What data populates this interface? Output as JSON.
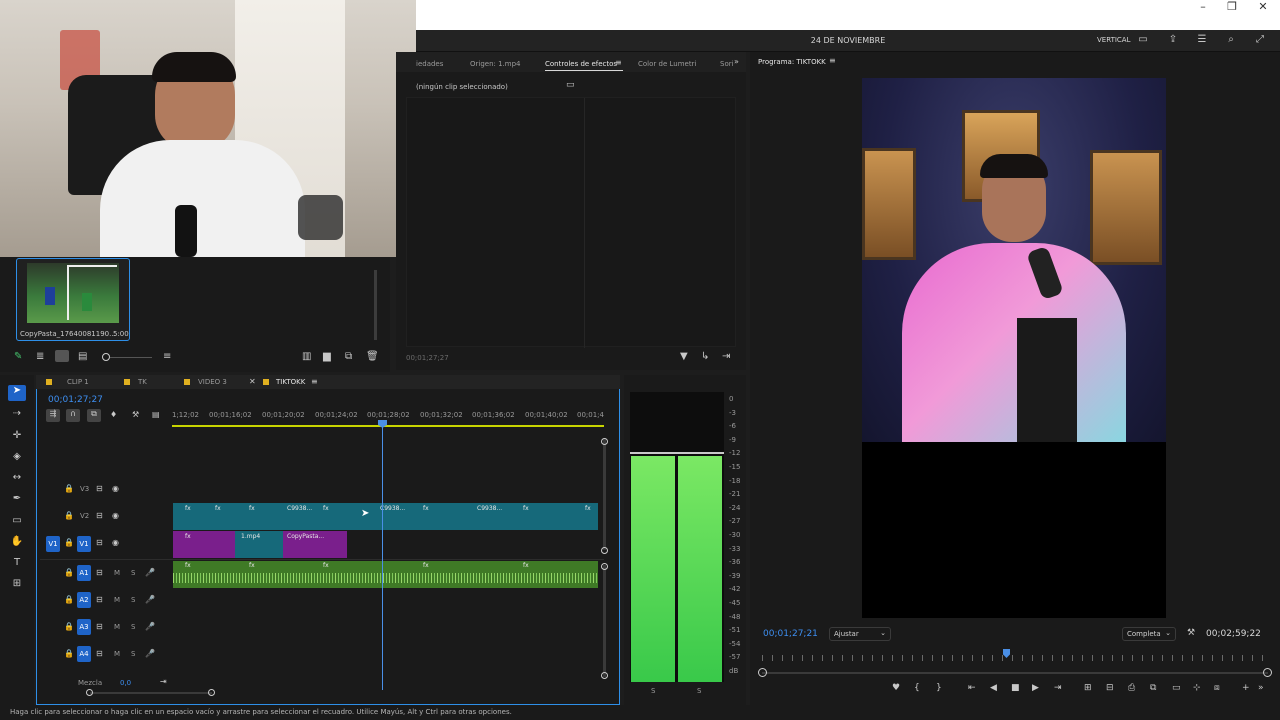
{
  "window": {
    "title": "24 DE NOVIEMBRE",
    "layout_mode": "VERTICAL",
    "controls": [
      "–",
      "❐",
      "✕"
    ]
  },
  "project_panel": {
    "clip_name": "CopyPasta_17640081190...",
    "clip_duration": "5:00",
    "tools": [
      "pencil-icon",
      "list-view-icon",
      "icon-view-icon",
      "freeform-view-icon",
      "zoom-slider",
      "sort-icon",
      "automate-icon",
      "new-bin-icon",
      "new-item-icon",
      "trash-icon"
    ]
  },
  "source_panel": {
    "tabs": [
      "iedades",
      "Origen: 1.mp4",
      "Controles de efectos",
      "Color de Lumetri",
      "Sori"
    ],
    "active_tab": "Controles de efectos",
    "no_clip": "(ningún clip seleccionado)",
    "timecode": "00;01;27;27"
  },
  "timeline": {
    "tabs": [
      "CLIP 1",
      "TK",
      "VIDEO 3",
      "TIKTOKK"
    ],
    "active_tab": "TIKTOKK",
    "timecode": "00;01;27;27",
    "ruler": [
      "1;12;02",
      "00;01;16;02",
      "00;01;20;02",
      "00;01;24;02",
      "00;01;28;02",
      "00;01;32;02",
      "00;01;36;02",
      "00;01;40;02",
      "00;01;4"
    ],
    "video_tracks": [
      {
        "name": "V3"
      },
      {
        "name": "V2"
      },
      {
        "name": "V1",
        "src": "V1"
      }
    ],
    "audio_tracks": [
      {
        "name": "A1",
        "m": "M",
        "s": "S"
      },
      {
        "name": "A2",
        "m": "M",
        "s": "S"
      },
      {
        "name": "A3",
        "m": "M",
        "s": "S"
      },
      {
        "name": "A4",
        "m": "M",
        "s": "S"
      }
    ],
    "mix_label": "Mezcla",
    "mix_value": "0,0",
    "clip_labels": {
      "v2a": "C9938...",
      "v2b": "C9938...",
      "v2c": "C9938...",
      "v1a": "1.mp4",
      "v1b": "CopyPasta..."
    },
    "fx": "fx"
  },
  "audio_meter": {
    "scale": [
      "0",
      "-3",
      "-6",
      "-9",
      "-12",
      "-15",
      "-18",
      "-21",
      "-24",
      "-27",
      "-30",
      "-33",
      "-36",
      "-39",
      "-42",
      "-45",
      "-48",
      "-51",
      "-54",
      "-57",
      "dB"
    ],
    "channels": [
      "S",
      "S"
    ]
  },
  "program_panel": {
    "title": "Programa: TIKTOKK",
    "timecode": "00;01;27;21",
    "fit": "Ajustar",
    "quality": "Completa",
    "duration": "00;02;59;22"
  },
  "status": {
    "text": "Haga clic para seleccionar o haga clic en un espacio vacío y arrastre para seleccionar el recuadro. Utilice Mayús, Alt y Ctrl para otras opciones."
  },
  "colors": {
    "accent": "#2e8fe8",
    "v2_clip": "#16697a",
    "v1_clip": "#7a1f8c",
    "a1_clip": "#3f7a26",
    "meter": "#5bd856"
  }
}
